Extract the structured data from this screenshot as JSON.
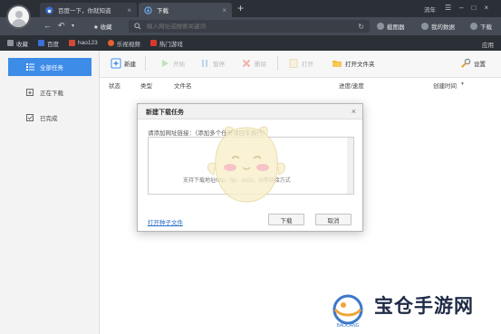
{
  "browser": {
    "tabs": [
      {
        "label": "百度一下，你就知道"
      },
      {
        "label": "下载"
      }
    ],
    "tab_add": "+",
    "user_label": "流年",
    "window_controls": [
      "☰",
      "–",
      "□",
      "×"
    ],
    "nav": {
      "favorites_label": "收藏",
      "address_placeholder": "输入网址或搜索关键词",
      "screenshot_label": "截图器",
      "cloud_label": "我的数据",
      "download_label": "下载"
    },
    "bookmarks": [
      {
        "label": "收藏",
        "color": "#8c939b"
      },
      {
        "label": "百度",
        "color": "#3b6fd6"
      },
      {
        "label": "hao123",
        "color": "#d24a35"
      },
      {
        "label": "乐视视频",
        "color": "#e5622f"
      },
      {
        "label": "热门游戏",
        "color": "#d9392c"
      }
    ],
    "bookmarks_apps": "应用"
  },
  "sidebar": {
    "items": [
      {
        "label": "全部任务",
        "icon": "list-icon",
        "active": true
      },
      {
        "label": "正在下载",
        "icon": "downloading-icon",
        "active": false
      },
      {
        "label": "已完成",
        "icon": "completed-icon",
        "active": false
      }
    ]
  },
  "toolbar": {
    "new_label": "新建",
    "start_label": "开始",
    "pause_label": "暂停",
    "delete_label": "删除",
    "open_label": "打开",
    "open_folder_label": "打开文件夹",
    "settings_label": "设置"
  },
  "table": {
    "headers": [
      "状态",
      "类型",
      "文件名",
      "进度/速度",
      "创建时间"
    ],
    "sort_indicator": "▼"
  },
  "modal": {
    "title": "新建下载任务",
    "close": "×",
    "hint": "请添加网址链接：（添加多个任务请回车换行）",
    "placeholder": "支持下载地址http、ftp、ed2k、bt等链接方式",
    "torrent_link": "打开种子文件",
    "download_button": "下载",
    "cancel_button": "取消"
  },
  "watermark": {
    "text": "宝仓手游网",
    "logo_text": "BAOCANG"
  },
  "colors": {
    "accent": "#3d8ce8",
    "chrome_dark": "#2b2f36",
    "chrome_mid": "#454b54",
    "link": "#2a6fc9"
  }
}
